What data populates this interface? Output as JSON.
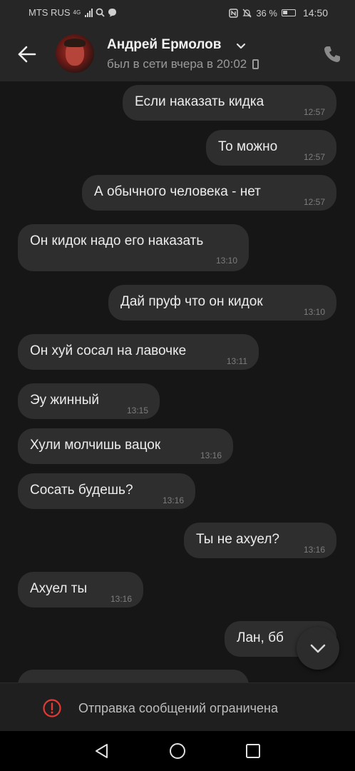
{
  "status_bar": {
    "carrier": "MTS RUS",
    "network": "4G",
    "battery": "36 %",
    "time": "14:50"
  },
  "header": {
    "contact_name": "Андрей Ермолов",
    "last_seen": "был в сети вчера в 20:02"
  },
  "messages": [
    {
      "side": "out",
      "text": "Если наказать кидка",
      "time": "12:57"
    },
    {
      "side": "out",
      "text": "То можно",
      "time": "12:57"
    },
    {
      "side": "out",
      "text": "А обычного человека - нет",
      "time": "12:57"
    },
    {
      "side": "in",
      "text": "Он кидок надо его наказать",
      "time": "13:10"
    },
    {
      "side": "out",
      "text": "Дай пруф что он кидок",
      "time": "13:10"
    },
    {
      "side": "in",
      "text": "Он хуй сосал на лавочке",
      "time": "13:11"
    },
    {
      "side": "in",
      "text": "Эу жинный",
      "time": "13:15"
    },
    {
      "side": "in",
      "text": "Хули молчишь вацок",
      "time": "13:16"
    },
    {
      "side": "in",
      "text": "Сосать будешь?",
      "time": "13:16"
    },
    {
      "side": "out",
      "text": "Ты не ахуел?",
      "time": "13:16"
    },
    {
      "side": "in",
      "text": "Ахуел ты",
      "time": "13:16"
    },
    {
      "side": "out",
      "text": "Лан, бб",
      "time": ""
    }
  ],
  "restriction_notice": "Отправка сообщений ограничена",
  "icons": {
    "back": "arrow-left-icon",
    "call": "phone-icon",
    "scroll_down": "chevron-down-icon",
    "warning": "alert-circle-icon",
    "nav_back": "triangle-back-icon",
    "nav_home": "circle-home-icon",
    "nav_recent": "square-recent-icon"
  },
  "colors": {
    "background": "#161616",
    "header": "#262626",
    "bubble": "#2e2e2e",
    "warning": "#e53935"
  }
}
